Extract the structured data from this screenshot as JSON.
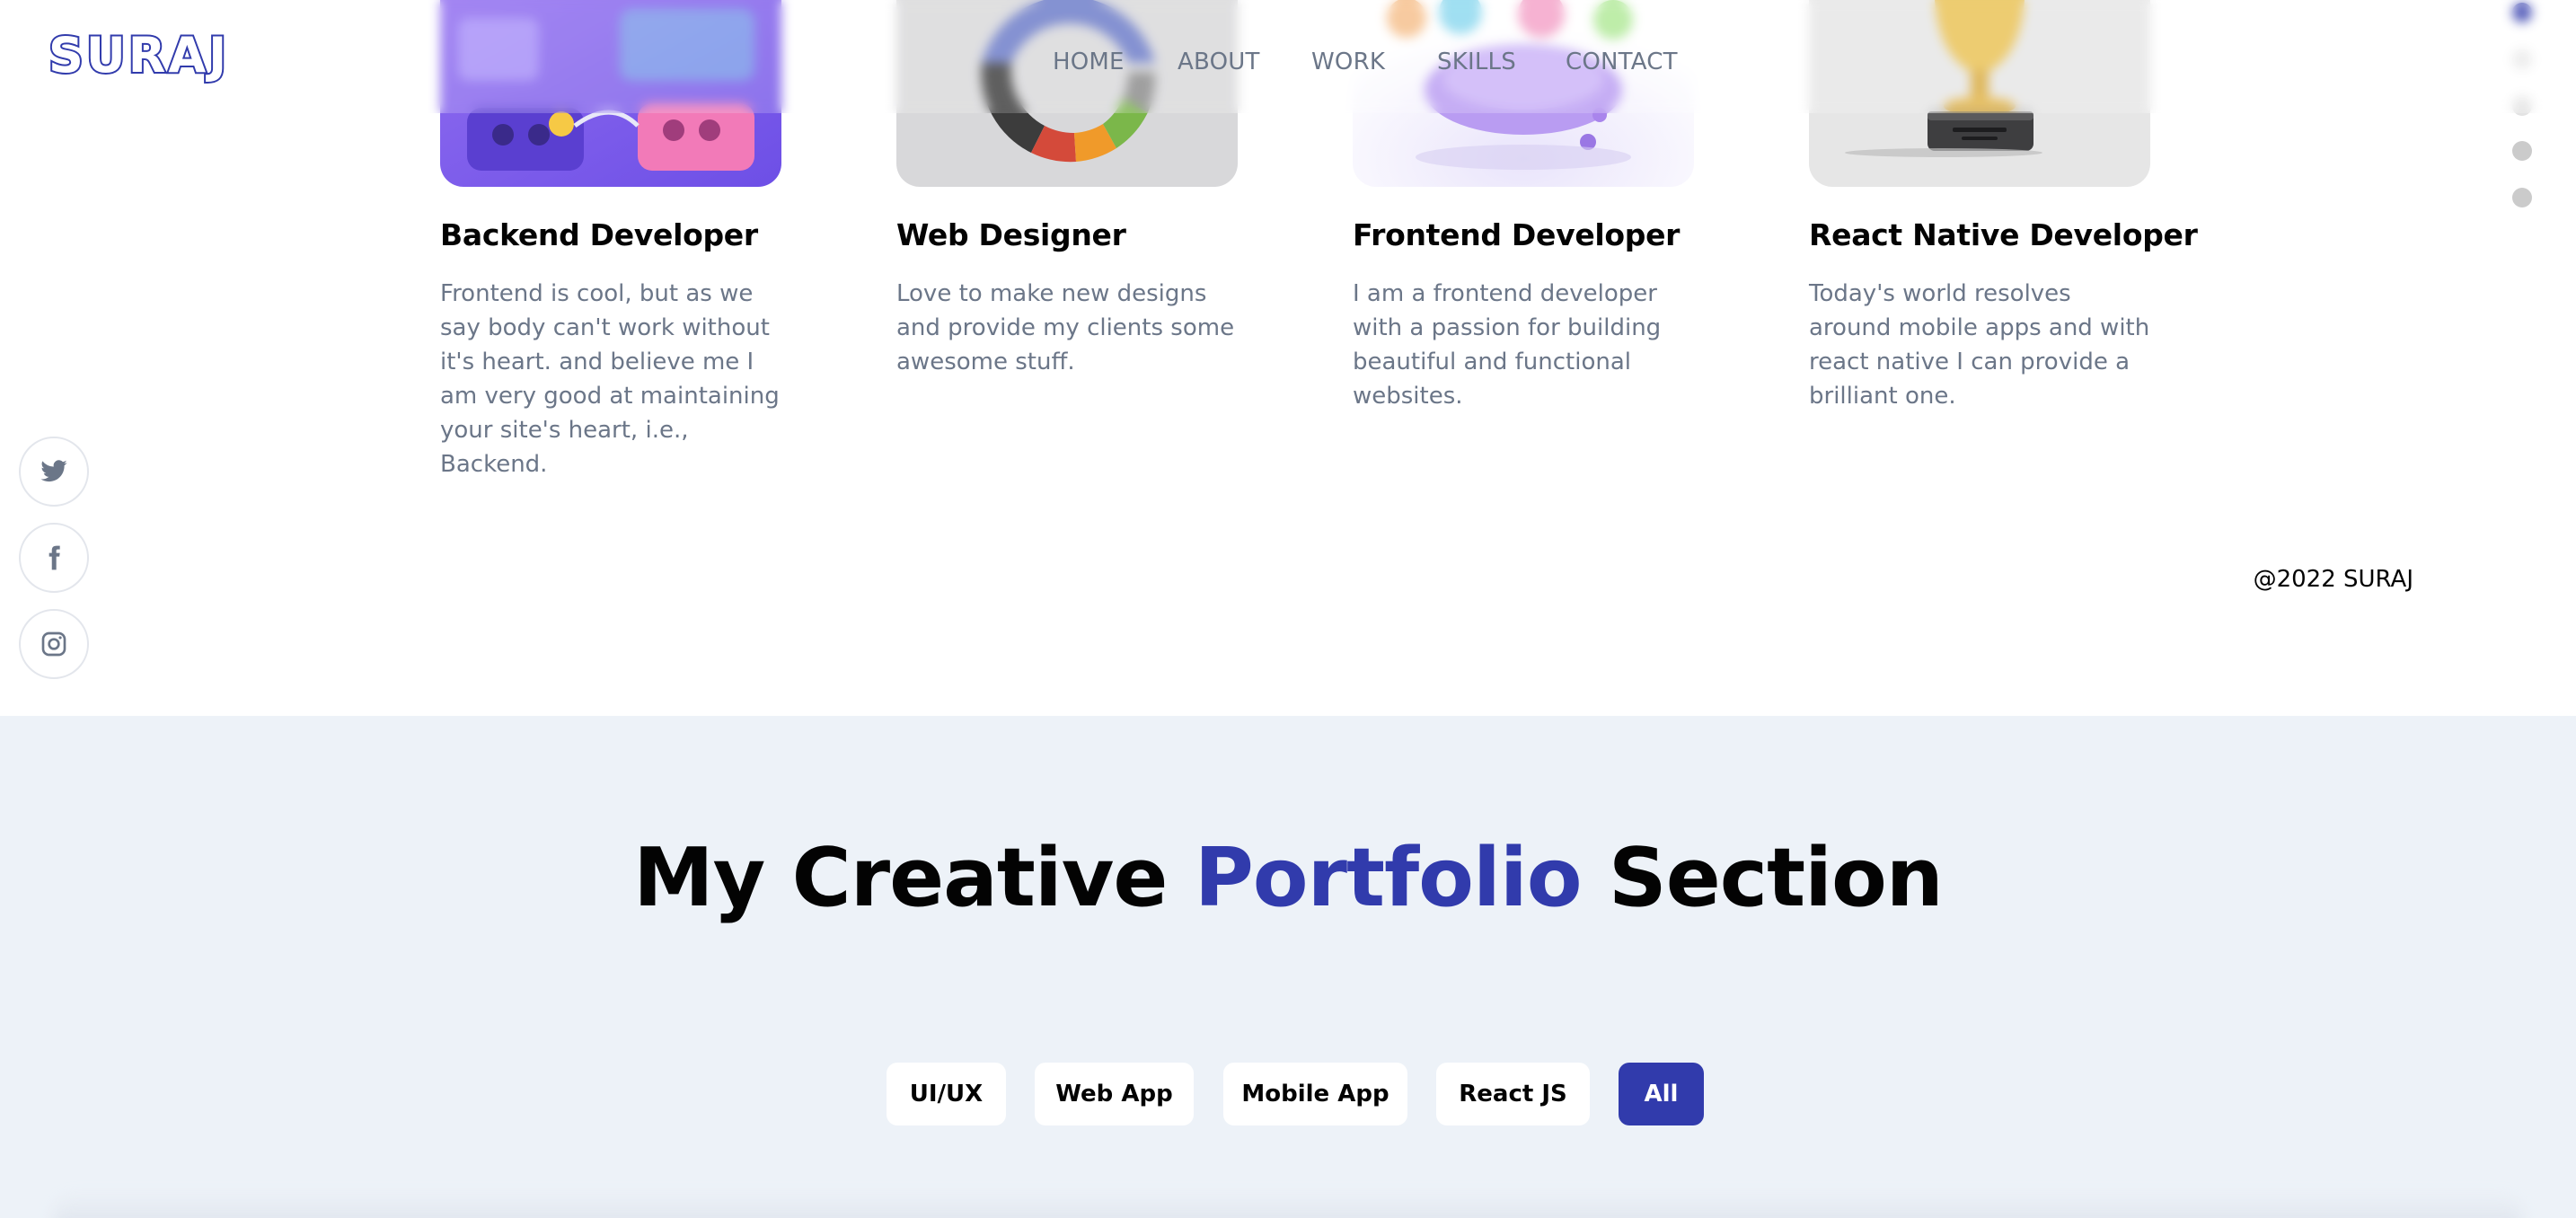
{
  "brand": {
    "logo_text": "SURAJ"
  },
  "navbar": {
    "links": [
      "HOME",
      "ABOUT",
      "WORK",
      "SKILLS",
      "CONTACT"
    ]
  },
  "social": [
    "twitter-icon",
    "facebook-icon",
    "instagram-icon"
  ],
  "section_dots": {
    "count": 5,
    "active_index": 0
  },
  "skills": [
    {
      "title": "Backend Developer",
      "description": "Frontend is cool, but as we say body can't work without it's heart. and believe me I am very good at maintaining your site's heart, i.e., Backend."
    },
    {
      "title": "Web Designer",
      "description": "Love to make new designs and provide my clients some awesome stuff."
    },
    {
      "title": "Frontend Developer",
      "description": "I am a frontend developer with a passion for building beautiful and functional websites."
    },
    {
      "title": "React Native Developer",
      "description": "Today's world resolves around mobile apps and with react native I can provide a brilliant one."
    }
  ],
  "footer": {
    "copyright": "@2022 SURAJ"
  },
  "portfolio": {
    "title_before": "My Creative",
    "title_accent": "Portfolio",
    "title_after": "Section",
    "filters": [
      "UI/UX",
      "Web App",
      "Mobile App",
      "React JS",
      "All"
    ],
    "active_filter": "All"
  },
  "colors": {
    "accent": "#313bac",
    "text_dark": "#030303",
    "text_gray": "#6b7688",
    "section_bg": "#edf2f8",
    "dot_inactive": "#cbcbcb"
  }
}
